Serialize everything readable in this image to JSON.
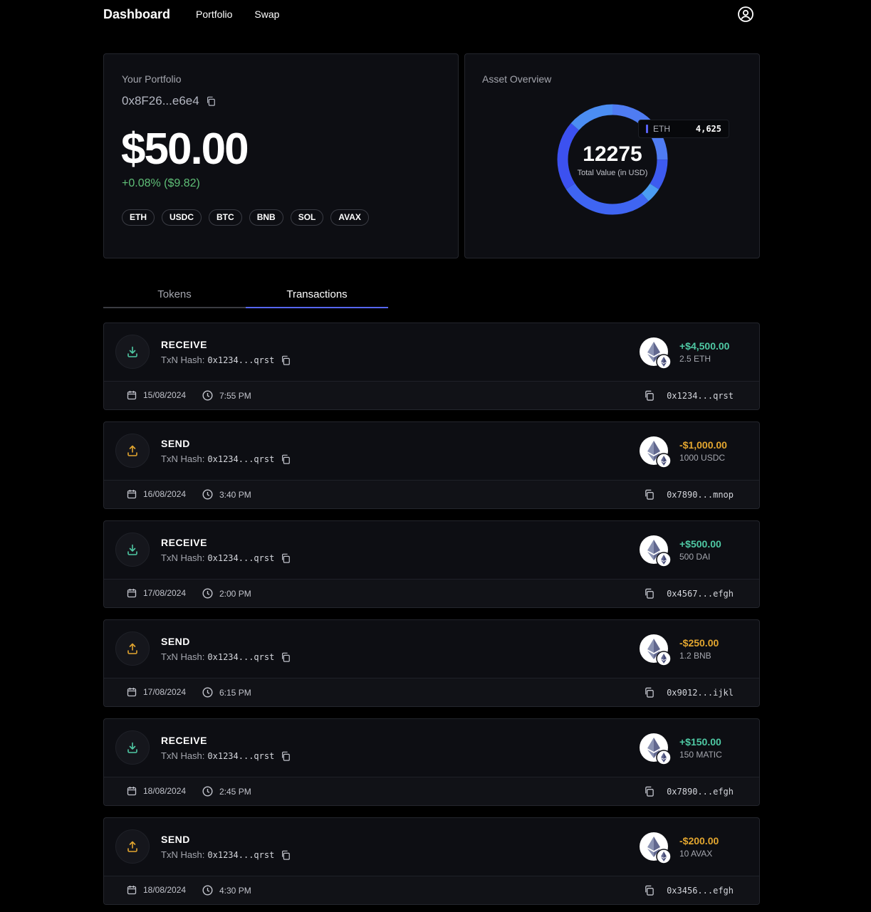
{
  "nav": {
    "brand": "Dashboard",
    "links": [
      "Portfolio",
      "Swap"
    ],
    "user_icon": "user-circle-icon"
  },
  "portfolio": {
    "label": "Your Portfolio",
    "address": "0x8F26...e6e4",
    "balance": "$50.00",
    "change": "+0.08% ($9.82)",
    "tokens": [
      "ETH",
      "USDC",
      "BTC",
      "BNB",
      "SOL",
      "AVAX"
    ]
  },
  "assets": {
    "label": "Asset Overview",
    "total": "12275",
    "total_label": "Total Value (in USD)",
    "tooltip": {
      "name": "ETH",
      "value": "4,625"
    },
    "colors": [
      "#4f7cf2",
      "#3d5bf0",
      "#4a9cf2",
      "#3f65f2",
      "#3c51f0",
      "#4b8df2"
    ],
    "segments": [
      {
        "name": "ETH",
        "value": 4625,
        "color": "#3d5bf0"
      }
    ]
  },
  "tabs": {
    "items": [
      "Tokens",
      "Transactions"
    ],
    "active": "Transactions"
  },
  "transactions": [
    {
      "type": "RECEIVE",
      "hash_label": "TxN Hash:",
      "hash": "0x1234...qrst",
      "amount": "+$4,500.00",
      "token_amount": "2.5 ETH",
      "date": "15/08/2024",
      "time": "7:55 PM",
      "address": "0x1234...qrst"
    },
    {
      "type": "SEND",
      "hash_label": "TxN Hash:",
      "hash": "0x1234...qrst",
      "amount": "-$1,000.00",
      "token_amount": "1000 USDC",
      "date": "16/08/2024",
      "time": "3:40 PM",
      "address": "0x7890...mnop"
    },
    {
      "type": "RECEIVE",
      "hash_label": "TxN Hash:",
      "hash": "0x1234...qrst",
      "amount": "+$500.00",
      "token_amount": "500 DAI",
      "date": "17/08/2024",
      "time": "2:00 PM",
      "address": "0x4567...efgh"
    },
    {
      "type": "SEND",
      "hash_label": "TxN Hash:",
      "hash": "0x1234...qrst",
      "amount": "-$250.00",
      "token_amount": "1.2 BNB",
      "date": "17/08/2024",
      "time": "6:15 PM",
      "address": "0x9012...ijkl"
    },
    {
      "type": "RECEIVE",
      "hash_label": "TxN Hash:",
      "hash": "0x1234...qrst",
      "amount": "+$150.00",
      "token_amount": "150 MATIC",
      "date": "18/08/2024",
      "time": "2:45 PM",
      "address": "0x7890...efgh"
    },
    {
      "type": "SEND",
      "hash_label": "TxN Hash:",
      "hash": "0x1234...qrst",
      "amount": "-$200.00",
      "token_amount": "10 AVAX",
      "date": "18/08/2024",
      "time": "4:30 PM",
      "address": "0x3456...efgh"
    }
  ]
}
